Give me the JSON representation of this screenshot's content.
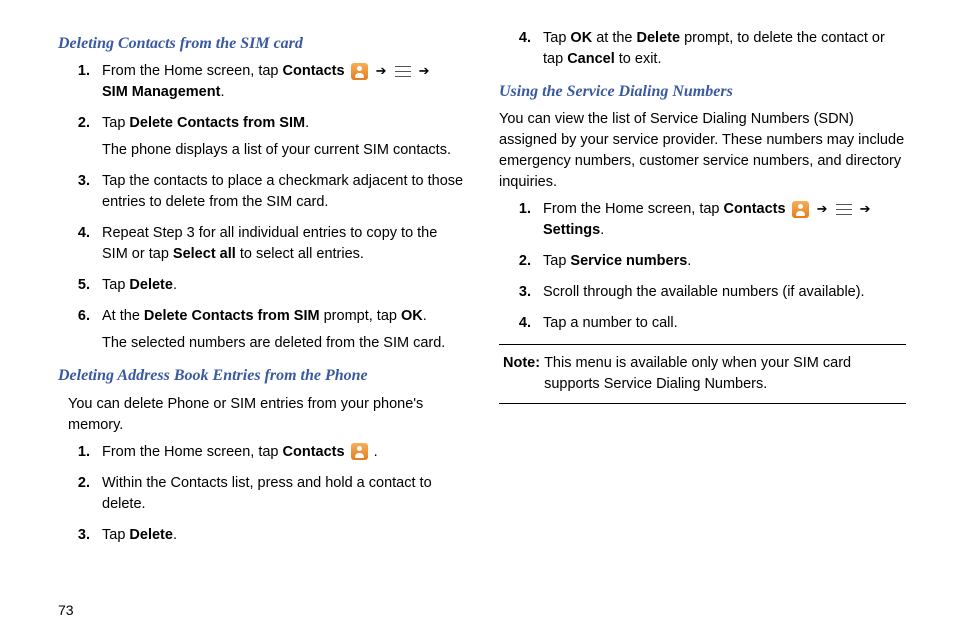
{
  "page_number": "73",
  "left": {
    "section1": {
      "title": "Deleting Contacts from the SIM card",
      "steps": {
        "s1a": "From the Home screen, tap ",
        "s1b": "Contacts",
        "s1c": "SIM Management",
        "s2a": "Tap ",
        "s2b": "Delete Contacts from SIM",
        "s2sub": "The phone displays a list of your current SIM contacts.",
        "s3": "Tap the contacts to place a checkmark adjacent to those entries to delete from the SIM card.",
        "s4a": "Repeat Step 3 for all individual entries to copy to the SIM or tap ",
        "s4b": "Select all",
        "s4c": " to select all entries.",
        "s5a": "Tap ",
        "s5b": "Delete",
        "s6a": "At the ",
        "s6b": "Delete Contacts from SIM",
        "s6c": " prompt, tap ",
        "s6d": "OK",
        "s6sub": "The selected numbers are deleted from the SIM card."
      }
    },
    "section2": {
      "title": "Deleting Address Book Entries from the Phone",
      "intro": "You can delete Phone or SIM entries from your phone's memory.",
      "steps": {
        "s1a": "From the Home screen, tap ",
        "s1b": "Contacts",
        "s2": "Within the Contacts list, press and hold a contact to delete.",
        "s3a": "Tap ",
        "s3b": "Delete"
      }
    }
  },
  "right": {
    "cont": {
      "s4a": "Tap ",
      "s4b": "OK",
      "s4c": " at the ",
      "s4d": "Delete",
      "s4e": " prompt, to delete the contact or tap ",
      "s4f": "Cancel",
      "s4g": " to exit."
    },
    "section3": {
      "title": "Using the Service Dialing Numbers",
      "intro": "You can view the list of Service Dialing Numbers (SDN) assigned by your service provider. These numbers may include emergency numbers, customer service numbers, and directory inquiries.",
      "steps": {
        "s1a": "From the Home screen, tap ",
        "s1b": "Contacts",
        "s1c": "Settings",
        "s2a": "Tap ",
        "s2b": "Service numbers",
        "s3": "Scroll through the available numbers (if available).",
        "s4": "Tap a number to call."
      }
    },
    "note": {
      "label": "Note:",
      "text": "This menu is available only when your SIM card supports Service Dialing Numbers."
    }
  },
  "arrow": "➔"
}
